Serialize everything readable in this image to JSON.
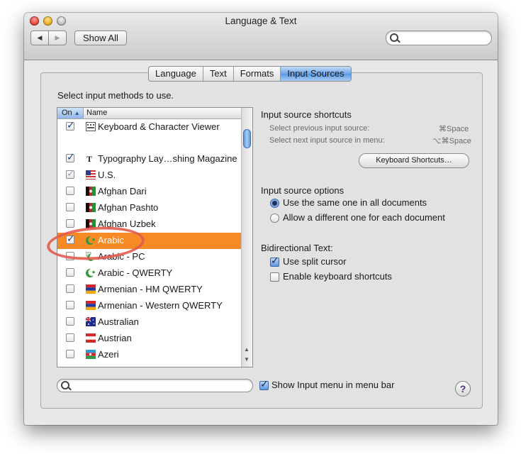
{
  "window": {
    "title": "Language & Text"
  },
  "toolbar": {
    "back_icon": "back-arrow-icon",
    "forward_icon": "forward-arrow-icon",
    "show_all_label": "Show All",
    "search_placeholder": ""
  },
  "tabs": [
    {
      "label": "Language",
      "active": false
    },
    {
      "label": "Text",
      "active": false
    },
    {
      "label": "Formats",
      "active": false
    },
    {
      "label": "Input Sources",
      "active": true
    }
  ],
  "input_methods": {
    "heading": "Select input methods to use.",
    "col_on": "On",
    "col_name": "Name",
    "rows": [
      {
        "checked": true,
        "label": "Keyboard & Character Viewer",
        "icon": "keyboard-viewer-icon"
      },
      {
        "checked": true,
        "label": "Typography Lay…shing Magazine",
        "icon": "typography-icon"
      },
      {
        "checked": true,
        "dim": true,
        "label": "U.S.",
        "icon": "us-flag-icon"
      },
      {
        "checked": false,
        "label": "Afghan Dari",
        "icon": "afghanistan-flag-icon"
      },
      {
        "checked": false,
        "label": "Afghan Pashto",
        "icon": "afghanistan-flag-icon"
      },
      {
        "checked": false,
        "label": "Afghan Uzbek",
        "icon": "afghanistan-flag-icon"
      },
      {
        "checked": true,
        "selected": true,
        "label": "Arabic",
        "icon": "crescent-icon"
      },
      {
        "checked": false,
        "label": "Arabic - PC",
        "icon": "crescent-pc-icon"
      },
      {
        "checked": false,
        "label": "Arabic - QWERTY",
        "icon": "crescent-icon"
      },
      {
        "checked": false,
        "label": "Armenian - HM QWERTY",
        "icon": "armenia-flag-icon"
      },
      {
        "checked": false,
        "label": "Armenian - Western QWERTY",
        "icon": "armenia-flag-icon"
      },
      {
        "checked": false,
        "label": "Australian",
        "icon": "australia-flag-icon"
      },
      {
        "checked": false,
        "label": "Austrian",
        "icon": "austria-flag-icon"
      },
      {
        "checked": false,
        "label": "Azeri",
        "icon": "azerbaijan-flag-icon"
      }
    ]
  },
  "shortcuts": {
    "title": "Input source shortcuts",
    "prev_label": "Select previous input source:",
    "prev_key": "⌘Space",
    "next_label": "Select next input source in menu:",
    "next_key": "⌥⌘Space",
    "button_label": "Keyboard Shortcuts…"
  },
  "options": {
    "title": "Input source options",
    "same_label": "Use the same one in all documents",
    "different_label": "Allow a different one for each document",
    "selected": "same"
  },
  "bidi": {
    "title": "Bidirectional Text:",
    "split_cursor_label": "Use split cursor",
    "split_cursor_checked": true,
    "kbd_shortcuts_label": "Enable keyboard shortcuts",
    "kbd_shortcuts_checked": false
  },
  "footer": {
    "show_menu_label": "Show Input menu in menu bar",
    "show_menu_checked": true,
    "help_label": "?"
  },
  "colors": {
    "selection": "#f68a24",
    "active_tab": "#5798e4",
    "annotation_circle": "#e35b4f"
  }
}
